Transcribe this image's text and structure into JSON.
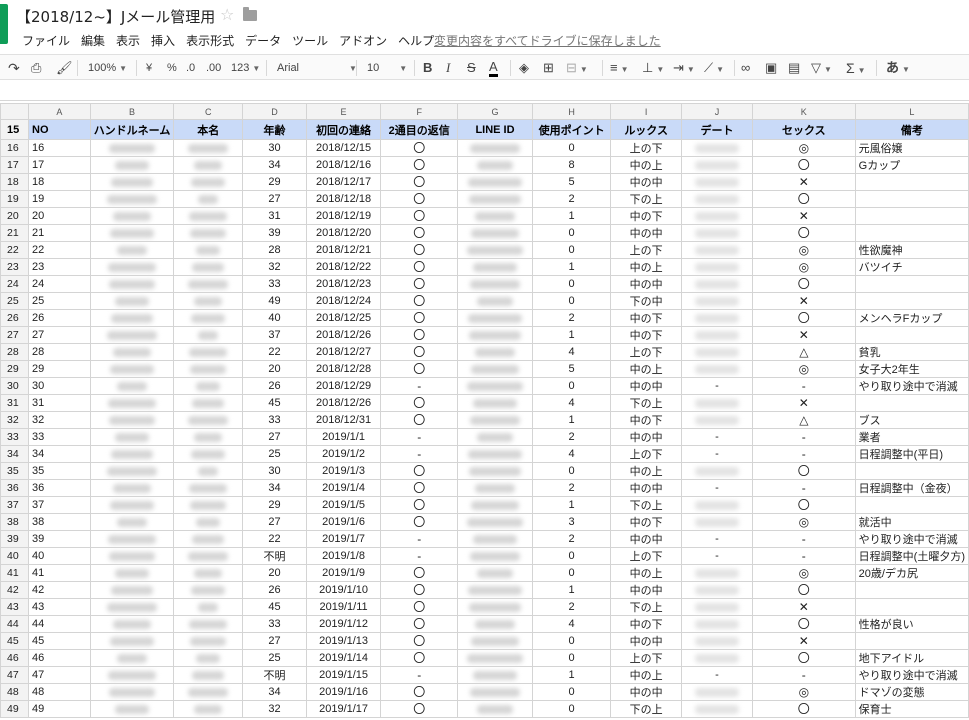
{
  "doc": {
    "title": "【2018/12~】Jメール管理用",
    "star_icon": "star-outline-icon",
    "folder_icon": "folder-icon"
  },
  "menu": [
    "ファイル",
    "編集",
    "表示",
    "挿入",
    "表示形式",
    "データ",
    "ツール",
    "アドオン",
    "ヘルプ"
  ],
  "save_status": "変更内容をすべてドライブに保存しました",
  "toolbar": {
    "undo_icon": "redo-icon",
    "print_icon": "print-icon",
    "paint_format_icon": "paint-format-icon",
    "zoom": "100%",
    "currency": "¥",
    "percent": "%",
    "decimal_decrease": ".0",
    "decimal_increase": ".00",
    "number_format": "123",
    "font": "Arial",
    "font_size": "10",
    "bold": "B",
    "italic": "I",
    "strike": "S",
    "text_color": "A",
    "ime": "あ"
  },
  "sheet": {
    "column_letters": [
      "A",
      "B",
      "C",
      "D",
      "E",
      "F",
      "G",
      "H",
      "I",
      "J",
      "K",
      "L"
    ],
    "headers": [
      "NO",
      "ハンドルネーム",
      "本名",
      "年齢",
      "初回の連絡",
      "2通目の返信",
      "LINE ID",
      "使用ポイント",
      "ルックス",
      "デート",
      "セックス",
      "備考"
    ],
    "rows": [
      {
        "no": "16",
        "age": "30",
        "first": "2018/12/15",
        "reply": "〇",
        "points": "0",
        "looks": "上の下",
        "date": "",
        "sex": "◎",
        "note": "元風俗嬢"
      },
      {
        "no": "17",
        "age": "34",
        "first": "2018/12/16",
        "reply": "〇",
        "points": "8",
        "looks": "中の上",
        "date": "",
        "sex": "〇",
        "note": "Gカップ"
      },
      {
        "no": "18",
        "age": "29",
        "first": "2018/12/17",
        "reply": "〇",
        "points": "5",
        "looks": "中の中",
        "date": "",
        "sex": "✕",
        "note": ""
      },
      {
        "no": "19",
        "age": "27",
        "first": "2018/12/18",
        "reply": "〇",
        "points": "2",
        "looks": "下の上",
        "date": "",
        "sex": "〇",
        "note": ""
      },
      {
        "no": "20",
        "age": "31",
        "first": "2018/12/19",
        "reply": "〇",
        "points": "1",
        "looks": "中の下",
        "date": "",
        "sex": "✕",
        "note": ""
      },
      {
        "no": "21",
        "age": "39",
        "first": "2018/12/20",
        "reply": "〇",
        "points": "0",
        "looks": "中の中",
        "date": "",
        "sex": "〇",
        "note": ""
      },
      {
        "no": "22",
        "age": "28",
        "first": "2018/12/21",
        "reply": "〇",
        "points": "0",
        "looks": "上の下",
        "date": "",
        "sex": "◎",
        "note": "性欲魔神"
      },
      {
        "no": "23",
        "age": "32",
        "first": "2018/12/22",
        "reply": "〇",
        "points": "1",
        "looks": "中の上",
        "date": "",
        "sex": "◎",
        "note": "バツイチ"
      },
      {
        "no": "24",
        "age": "33",
        "first": "2018/12/23",
        "reply": "〇",
        "points": "0",
        "looks": "中の中",
        "date": "",
        "sex": "〇",
        "note": ""
      },
      {
        "no": "25",
        "age": "49",
        "first": "2018/12/24",
        "reply": "〇",
        "points": "0",
        "looks": "下の中",
        "date": "",
        "sex": "✕",
        "note": ""
      },
      {
        "no": "26",
        "age": "40",
        "first": "2018/12/25",
        "reply": "〇",
        "points": "2",
        "looks": "中の下",
        "date": "",
        "sex": "〇",
        "note": "メンヘラFカップ"
      },
      {
        "no": "27",
        "age": "37",
        "first": "2018/12/26",
        "reply": "〇",
        "points": "1",
        "looks": "中の下",
        "date": "",
        "sex": "✕",
        "note": ""
      },
      {
        "no": "28",
        "age": "22",
        "first": "2018/12/27",
        "reply": "〇",
        "points": "4",
        "looks": "上の下",
        "date": "",
        "sex": "△",
        "note": "貧乳"
      },
      {
        "no": "29",
        "age": "20",
        "first": "2018/12/28",
        "reply": "〇",
        "points": "5",
        "looks": "中の上",
        "date": "",
        "sex": "◎",
        "note": "女子大2年生"
      },
      {
        "no": "30",
        "age": "26",
        "first": "2018/12/29",
        "reply": "-",
        "points": "0",
        "looks": "中の中",
        "date": "-",
        "sex": "-",
        "note": "やり取り途中で消滅"
      },
      {
        "no": "31",
        "age": "45",
        "first": "2018/12/26",
        "reply": "〇",
        "points": "4",
        "looks": "下の上",
        "date": "",
        "sex": "✕",
        "note": ""
      },
      {
        "no": "32",
        "age": "33",
        "first": "2018/12/31",
        "reply": "〇",
        "points": "1",
        "looks": "中の下",
        "date": "",
        "sex": "△",
        "note": "ブス"
      },
      {
        "no": "33",
        "age": "27",
        "first": "2019/1/1",
        "reply": "-",
        "points": "2",
        "looks": "中の中",
        "date": "-",
        "sex": "-",
        "note": "業者"
      },
      {
        "no": "34",
        "age": "25",
        "first": "2019/1/2",
        "reply": "-",
        "points": "4",
        "looks": "上の下",
        "date": "-",
        "sex": "-",
        "note": "日程調整中(平日)"
      },
      {
        "no": "35",
        "age": "30",
        "first": "2019/1/3",
        "reply": "〇",
        "points": "0",
        "looks": "中の上",
        "date": "",
        "sex": "〇",
        "note": ""
      },
      {
        "no": "36",
        "age": "34",
        "first": "2019/1/4",
        "reply": "〇",
        "points": "2",
        "looks": "中の中",
        "date": "-",
        "sex": "-",
        "note": "日程調整中（金夜）"
      },
      {
        "no": "37",
        "age": "29",
        "first": "2019/1/5",
        "reply": "〇",
        "points": "1",
        "looks": "下の上",
        "date": "",
        "sex": "〇",
        "note": ""
      },
      {
        "no": "38",
        "age": "27",
        "first": "2019/1/6",
        "reply": "〇",
        "points": "3",
        "looks": "中の下",
        "date": "",
        "sex": "◎",
        "note": "就活中"
      },
      {
        "no": "39",
        "age": "22",
        "first": "2019/1/7",
        "reply": "-",
        "points": "2",
        "looks": "中の中",
        "date": "-",
        "sex": "-",
        "note": "やり取り途中で消滅"
      },
      {
        "no": "40",
        "age": "不明",
        "first": "2019/1/8",
        "reply": "-",
        "points": "0",
        "looks": "上の下",
        "date": "-",
        "sex": "-",
        "note": "日程調整中(土曜夕方)"
      },
      {
        "no": "41",
        "age": "20",
        "first": "2019/1/9",
        "reply": "〇",
        "points": "0",
        "looks": "中の上",
        "date": "",
        "sex": "◎",
        "note": "20歳/デカ尻"
      },
      {
        "no": "42",
        "age": "26",
        "first": "2019/1/10",
        "reply": "〇",
        "points": "1",
        "looks": "中の中",
        "date": "",
        "sex": "〇",
        "note": ""
      },
      {
        "no": "43",
        "age": "45",
        "first": "2019/1/11",
        "reply": "〇",
        "points": "2",
        "looks": "下の上",
        "date": "",
        "sex": "✕",
        "note": ""
      },
      {
        "no": "44",
        "age": "33",
        "first": "2019/1/12",
        "reply": "〇",
        "points": "4",
        "looks": "中の下",
        "date": "",
        "sex": "〇",
        "note": "性格が良い"
      },
      {
        "no": "45",
        "age": "27",
        "first": "2019/1/13",
        "reply": "〇",
        "points": "0",
        "looks": "中の中",
        "date": "",
        "sex": "✕",
        "note": ""
      },
      {
        "no": "46",
        "age": "25",
        "first": "2019/1/14",
        "reply": "〇",
        "points": "0",
        "looks": "上の下",
        "date": "",
        "sex": "〇",
        "note": "地下アイドル"
      },
      {
        "no": "47",
        "age": "不明",
        "first": "2019/1/15",
        "reply": "-",
        "points": "1",
        "looks": "中の上",
        "date": "-",
        "sex": "-",
        "note": "やり取り途中で消滅"
      },
      {
        "no": "48",
        "age": "34",
        "first": "2019/1/16",
        "reply": "〇",
        "points": "0",
        "looks": "中の中",
        "date": "",
        "sex": "◎",
        "note": "ドマゾの変態"
      },
      {
        "no": "49",
        "age": "32",
        "first": "2019/1/17",
        "reply": "〇",
        "points": "0",
        "looks": "下の上",
        "date": "",
        "sex": "〇",
        "note": "保育士"
      }
    ]
  },
  "colors": {
    "header_bg": "#c9daf8",
    "logo_green": "#0f9d58"
  }
}
